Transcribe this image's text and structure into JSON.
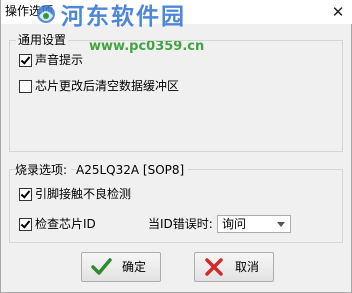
{
  "window": {
    "title": "操作选项",
    "close_glyph": "✕"
  },
  "watermark": {
    "site_name": "河东软件园",
    "url": "www.pc0359.cn"
  },
  "general_group": {
    "legend": "通用设置",
    "items": [
      {
        "label": "声音提示",
        "checked": true
      },
      {
        "label": "芯片更改后清空数据缓冲区",
        "checked": false
      }
    ]
  },
  "burn_group": {
    "legend": "烧录选项:",
    "chip": "A25LQ32A [SOP8]",
    "items": [
      {
        "label": "引脚接触不良检测",
        "checked": true
      },
      {
        "label": "检查芯片ID",
        "checked": true
      }
    ],
    "id_error_label": "当ID错误时:",
    "id_error_select": {
      "value": "询问"
    }
  },
  "buttons": {
    "ok_label": "确定",
    "cancel_label": "取消"
  },
  "icons": {
    "close": "close-icon",
    "ok": "green-check-icon",
    "cancel": "red-x-icon",
    "dropdown": "chevron-down-icon"
  },
  "colors": {
    "ok_icon": "#2e8b2e",
    "cancel_icon": "#d12b2b",
    "watermark_title": "#3b7bd4",
    "watermark_url": "#2e9c2e"
  }
}
